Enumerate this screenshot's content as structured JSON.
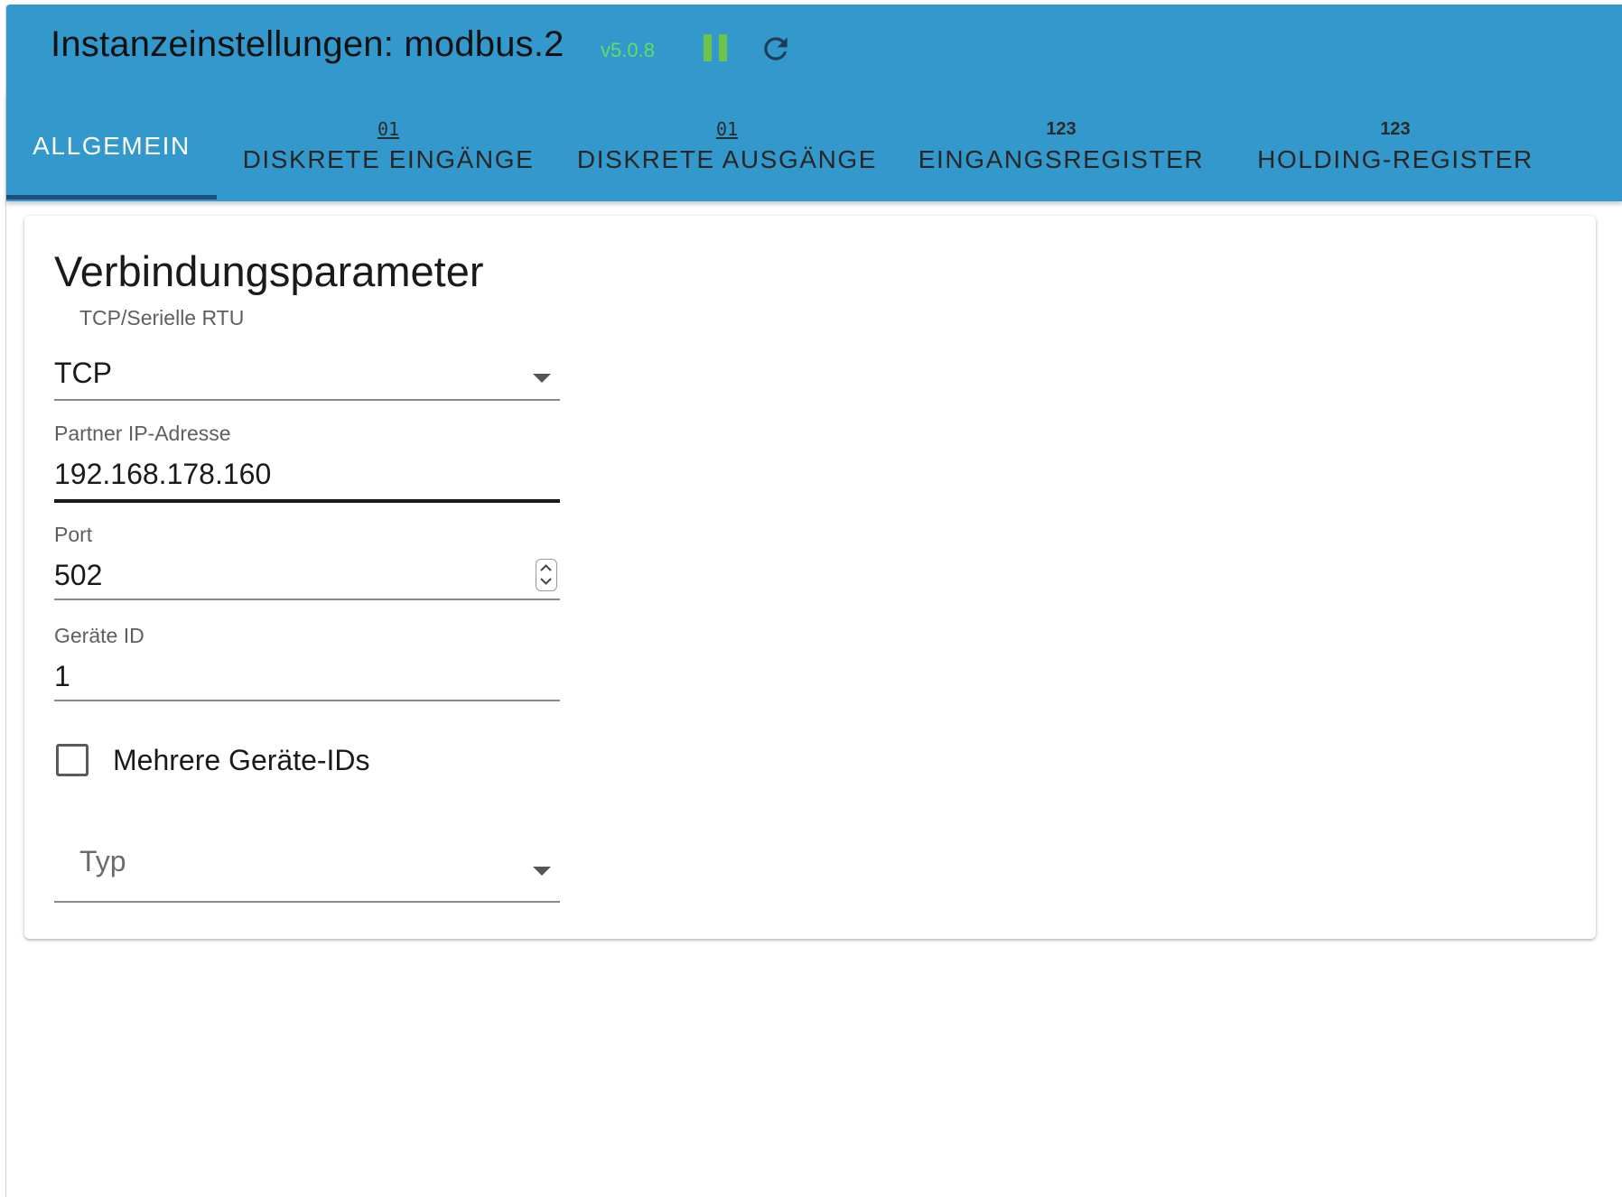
{
  "header": {
    "title": "Instanzeinstellungen: modbus.2",
    "version": "v5.0.8",
    "pause_icon": "pause-icon",
    "reload_icon": "reload-icon",
    "colors": {
      "background": "#3399cc",
      "version": "#5ee05e",
      "pause": "#6cc24a"
    }
  },
  "tabs": [
    {
      "label": "ALLGEMEIN",
      "icon": "",
      "active": true
    },
    {
      "label": "DISKRETE EINGÄNGE",
      "icon": "01",
      "active": false
    },
    {
      "label": "DISKRETE AUSGÄNGE",
      "icon": "01",
      "active": false
    },
    {
      "label": "EINGANGSREGISTER",
      "icon": "123",
      "active": false
    },
    {
      "label": "HOLDING-REGISTER",
      "icon": "123",
      "active": false
    }
  ],
  "card": {
    "title": "Verbindungsparameter",
    "fields": {
      "mode": {
        "label": "TCP/Serielle RTU",
        "value": "TCP"
      },
      "ip": {
        "label": "Partner IP-Adresse",
        "value": "192.168.178.160"
      },
      "port": {
        "label": "Port",
        "value": "502"
      },
      "device_id": {
        "label": "Geräte ID",
        "value": "1"
      },
      "multi_ids": {
        "label": "Mehrere Geräte-IDs",
        "checked": false
      },
      "type": {
        "placeholder": "Typ",
        "value": ""
      }
    }
  }
}
